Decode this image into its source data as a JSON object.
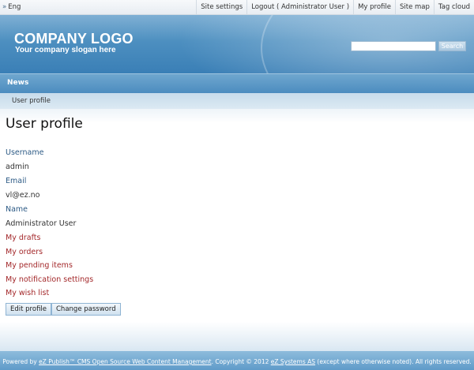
{
  "topbar": {
    "lang_label": "Eng",
    "links": [
      "Site settings",
      "Logout ( Administrator User )",
      "My profile",
      "Site map",
      "Tag cloud"
    ]
  },
  "header": {
    "logo": "COMPANY LOGO",
    "slogan": "Your company slogan here",
    "search_value": "",
    "search_button": "Search"
  },
  "nav": {
    "items": [
      "News"
    ]
  },
  "breadcrumb": [
    "User profile"
  ],
  "page": {
    "title": "User profile",
    "username_label": "Username",
    "username_value": "admin",
    "email_label": "Email",
    "email_value": "vl@ez.no",
    "name_label": "Name",
    "name_value": "Administrator User",
    "links": [
      "My drafts",
      "My orders",
      "My pending items",
      "My notification settings",
      "My wish list"
    ],
    "edit_button": "Edit profile",
    "password_button": "Change password"
  },
  "footer": {
    "prefix": "Powered by ",
    "link1": "eZ Publish™ CMS Open Source Web Content Management",
    "middle": ". Copyright © 2012 ",
    "link2": "eZ Systems AS",
    "suffix": " (except where otherwise noted). All rights reserved."
  },
  "colors": {
    "header_blue": "#4d8fc0",
    "label_blue": "#2c5a85",
    "link_red": "#a3282a"
  }
}
